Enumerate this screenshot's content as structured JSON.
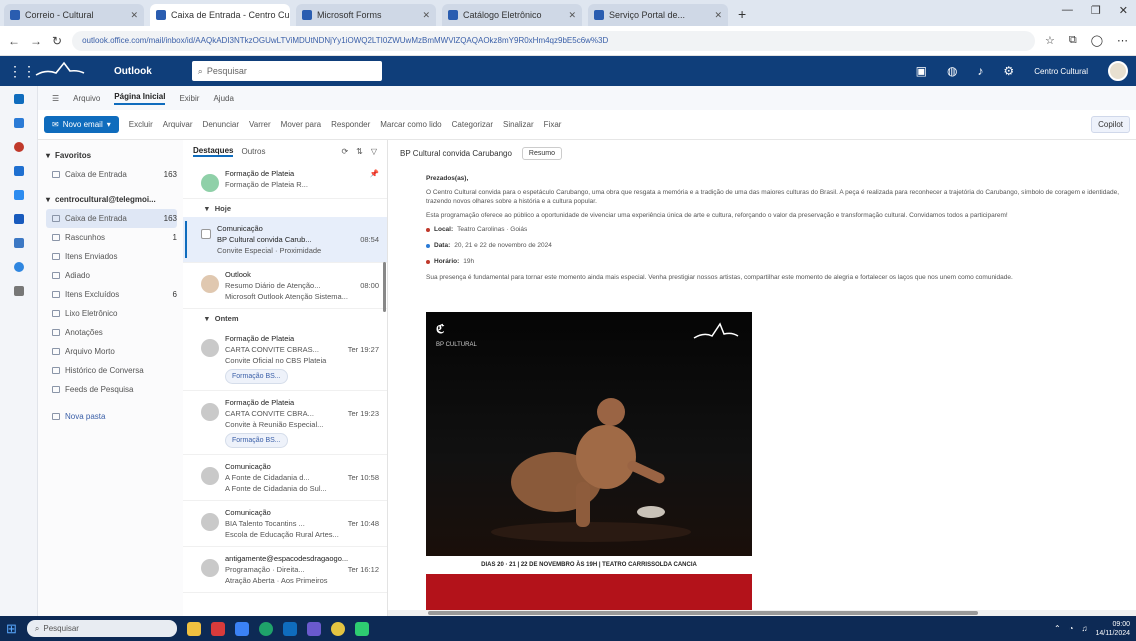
{
  "browser": {
    "tabs": [
      {
        "label": "Correio - Cultural",
        "active": false
      },
      {
        "label": "Caixa de Entrada - Centro Cult...",
        "active": true
      },
      {
        "label": "Microsoft Forms",
        "active": false
      },
      {
        "label": "Catálogo Eletrônico",
        "active": false
      },
      {
        "label": "Serviço Portal de...",
        "active": false
      }
    ],
    "url": "outlook.office.com/mail/inbox/id/AAQkADI3NTkzOGUwLTViMDUtNDNjYy1iOWQ2LTI0ZWUwMzBmMWVlZQAQAOkz8mY9R0xHm4qz9bE5c6w%3D",
    "window_controls": [
      "—",
      "❐",
      "✕"
    ]
  },
  "outlook": {
    "app_name": "Outlook",
    "search_placeholder": "Pesquisar",
    "account_name": "Centro Cultural"
  },
  "ribbon": {
    "tabs": [
      "Arquivo",
      "Página Inicial",
      "Exibir",
      "Ajuda"
    ],
    "active_tab": "Página Inicial",
    "new_mail": "Novo email",
    "actions": [
      "Excluir",
      "Arquivar",
      "Denunciar",
      "Varrer",
      "Mover para",
      "Responder",
      "Marcar como lido",
      "Categorizar",
      "Sinalizar",
      "Fixar"
    ],
    "copilot": "Copilot"
  },
  "folders": {
    "favorites_header": "Favoritos",
    "favorites": [
      {
        "label": "Caixa de Entrada",
        "count": "163"
      }
    ],
    "account_header": "centrocultural@telegmoi...",
    "items": [
      {
        "label": "Caixa de Entrada",
        "count": "163",
        "selected": true
      },
      {
        "label": "Rascunhos",
        "count": "1",
        "selected": false
      },
      {
        "label": "Itens Enviados",
        "count": "",
        "selected": false
      },
      {
        "label": "Adiado",
        "count": "",
        "selected": false
      },
      {
        "label": "Itens Excluídos",
        "count": "6",
        "selected": false
      },
      {
        "label": "Lixo Eletrônico",
        "count": "",
        "selected": false
      },
      {
        "label": "Anotações",
        "count": "",
        "selected": false
      },
      {
        "label": "Arquivo Morto",
        "count": "",
        "selected": false
      },
      {
        "label": "Histórico de Conversa",
        "count": "",
        "selected": false
      },
      {
        "label": "Feeds de Pesquisa",
        "count": "",
        "selected": false
      }
    ],
    "add_group": "Nova pasta"
  },
  "list": {
    "tabs": [
      "Destaques",
      "Outros"
    ],
    "pinned": {
      "sender": "Formação de Plateia",
      "preview": "Formação de Plateia R...",
      "time": ""
    },
    "groups": [
      {
        "label": "Hoje",
        "messages": [
          {
            "sender": "Comunicação",
            "subject": "BP Cultural convida Carub...",
            "time": "08:54",
            "preview": "Convite Especial · Proximidade",
            "selected": true,
            "chip": ""
          },
          {
            "sender": "Outlook",
            "subject": "Resumo Diário de Atenção...",
            "time": "08:00",
            "preview": "Microsoft Outlook Atenção Sistema...",
            "selected": false,
            "chip": ""
          }
        ]
      },
      {
        "label": "Ontem",
        "messages": [
          {
            "sender": "Formação de Plateia",
            "subject": "CARTA CONVITE CBRAS...",
            "time": "Ter 19:27",
            "preview": "Convite Oficial no CBS Plateia",
            "selected": false,
            "chip": "Formação BS..."
          },
          {
            "sender": "Formação de Plateia",
            "subject": "CARTA CONVITE CBRA...",
            "time": "Ter 19:23",
            "preview": "Convite à Reunião Especial...",
            "selected": false,
            "chip": "Formação BS..."
          },
          {
            "sender": "Comunicação",
            "subject": "A Fonte de Cidadania d...",
            "time": "Ter 10:58",
            "preview": "A Fonte de Cidadania do Sul...",
            "selected": false,
            "chip": ""
          },
          {
            "sender": "Comunicação",
            "subject": "BIA Talento Tocantins ...",
            "time": "Ter 10:48",
            "preview": "Escola de Educação Rural Artes...",
            "selected": false,
            "chip": ""
          },
          {
            "sender": "antigamente@espacodesdragaogo...",
            "subject": "Programação · Direita...",
            "time": "Ter 16:12",
            "preview": "Atração Aberta · Aos Primeiros",
            "selected": false,
            "chip": ""
          }
        ]
      }
    ]
  },
  "reading": {
    "subject": "BP Cultural convida Carubango",
    "summary_button": "Resumo",
    "greeting": "Prezados(as),",
    "paragraph1": "O Centro Cultural convida para o espetáculo Carubango, uma obra que resgata a memória e a tradição de uma das maiores culturas do Brasil. A peça é realizada para reconhecer a trajetória do Carubango, símbolo de coragem e identidade, trazendo novos olhares sobre a história e a cultura popular.",
    "paragraph2": "Esta programação oferece ao público a oportunidade de vivenciar uma experiência única de arte e cultura, reforçando o valor da preservação e transformação cultural. Convidamos todos a participarem!",
    "details": [
      {
        "label": "Local:",
        "value": "Teatro Carolinas · Goiás"
      },
      {
        "label": "Data:",
        "value": "20, 21 e 22 de novembro de 2024"
      },
      {
        "label": "Horário:",
        "value": "19h"
      }
    ],
    "closing": "Sua presença é fundamental para tornar este momento ainda mais especial. Venha prestigiar nossos artistas, compartilhar este momento de alegria e fortalecer os laços que nos unem como comunidade.",
    "poster": {
      "org": "BP CULTURAL",
      "dates_line": "DIAS 20 · 21 | 22 DE NOVEMBRO ÀS 19H | TEATRO CARRISSOLDA CANCIA"
    }
  },
  "taskbar": {
    "search_placeholder": "Pesquisar",
    "time": "09:00",
    "date": "14/11/2024"
  },
  "colors": {
    "outlook_header": "#0f3e7a",
    "accent": "#0f6cbd",
    "poster_red": "#b3121a",
    "taskbar": "#0d2a55"
  }
}
